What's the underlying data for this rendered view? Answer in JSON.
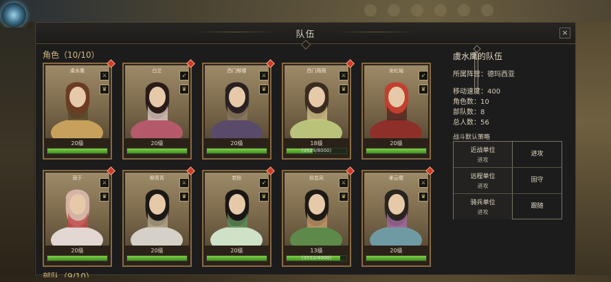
{
  "window": {
    "title": "队伍",
    "close_label": "×"
  },
  "roles_section": {
    "label": "角色（10/10）"
  },
  "troops_section": {
    "label": "部队（9/10）"
  },
  "cards": [
    {
      "name": "虞水鹰",
      "level": "20级",
      "xp_fraction": 1.0,
      "xp_text": "",
      "gem": true
    },
    {
      "name": "白芷",
      "level": "20级",
      "xp_fraction": 1.0,
      "xp_text": "",
      "gem": true
    },
    {
      "name": "西门郁楼",
      "level": "20级",
      "xp_fraction": 1.0,
      "xp_text": "",
      "gem": true
    },
    {
      "name": "西门薇薇",
      "level": "18级",
      "xp_fraction": 0.44,
      "xp_text": "(3529/8000)",
      "gem": true
    },
    {
      "name": "安红袖",
      "level": "20级",
      "xp_fraction": 1.0,
      "xp_text": "",
      "gem": false
    },
    {
      "name": "雨于",
      "level": "20级",
      "xp_fraction": 1.0,
      "xp_text": "",
      "gem": true
    },
    {
      "name": "柳青青",
      "level": "20级",
      "xp_fraction": 1.0,
      "xp_text": "",
      "gem": true
    },
    {
      "name": "若彤",
      "level": "20级",
      "xp_fraction": 1.0,
      "xp_text": "",
      "gem": true
    },
    {
      "name": "段芸凤",
      "level": "13级",
      "xp_fraction": 0.9,
      "xp_text": "(3552/4000)",
      "gem": true
    },
    {
      "name": "柔云缨",
      "level": "20级",
      "xp_fraction": 1.0,
      "xp_text": "",
      "gem": true
    }
  ],
  "info": {
    "title": "虞水鹰的队伍",
    "faction": "所属阵营：德玛西亚",
    "move_speed": "移动速度：400",
    "role_count": "角色数：10",
    "troop_count": "部队数：8",
    "total": "总人数：56"
  },
  "strategy": {
    "title": "战斗默认策略",
    "rows": [
      {
        "unit": "近战单位",
        "stance": "进攻",
        "action": "进攻"
      },
      {
        "unit": "远程单位",
        "stance": "进攻",
        "action": "固守"
      },
      {
        "unit": "骑兵单位",
        "stance": "进攻",
        "action": "跟随"
      }
    ]
  },
  "colors": {
    "xp_green": "#5fb734",
    "gem_red": "#d13a2a",
    "accent_gold": "#d6b980"
  },
  "icons": [
    "close-icon",
    "sword-icon",
    "crown-icon",
    "bow-icon",
    "gem-icon"
  ]
}
